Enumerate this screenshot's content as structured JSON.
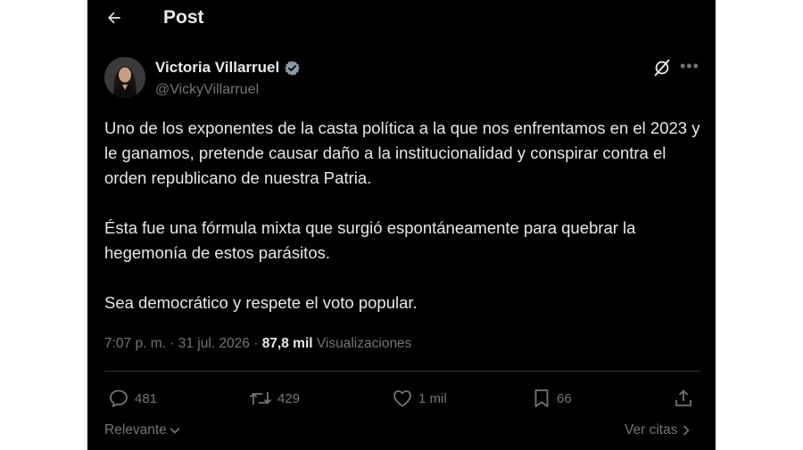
{
  "header": {
    "title": "Post",
    "back_icon": "arrow-left-icon"
  },
  "author": {
    "name": "Victoria Villarruel",
    "handle": "@VickyVillarruel",
    "verified_icon": "verified-badge-icon",
    "verified_color": "#8b98a5"
  },
  "tweet": {
    "paragraphs": [
      "Uno de los exponentes de la casta política a la que nos enfrentamos en el 2023 y le ganamos, pretende causar daño a la institucionalidad y conspirar contra el orden republicano de nuestra Patria.",
      "Ésta fue una fórmula mixta que surgió espontáneamente para quebrar la hegemonía de estos parásitos.",
      "Sea democrático y respete el voto popular."
    ]
  },
  "meta": {
    "time": "7:07 p. m.",
    "separator": "·",
    "date": "31 jul. 2026",
    "views_count": "87,8 mil",
    "views_label": "Visualizaciones"
  },
  "actions": {
    "replies": "481",
    "reposts": "429",
    "likes": "1 mil",
    "bookmarks": "66"
  },
  "footer": {
    "sort_label": "Relevante",
    "quotes_label": "Ver citas"
  },
  "colors": {
    "background": "#000000",
    "text": "#e7e9ea",
    "secondary": "#71767b",
    "divider": "#2f3336"
  }
}
